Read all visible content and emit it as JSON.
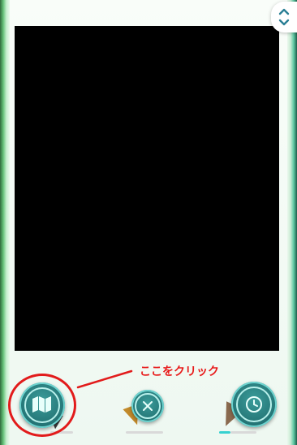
{
  "annotation": {
    "callout_text": "ここをクリック",
    "color": "#e81a1a"
  },
  "controls": {
    "scroll_toggle_icon": "up-down-chevron-icon",
    "map_button_icon": "map-icon",
    "close_button_icon": "close-icon",
    "clock_button_icon": "clock-icon"
  },
  "colors": {
    "teal": "#237374",
    "teal_light": "#6ed3cf",
    "accent_cyan": "#36d1d0"
  }
}
